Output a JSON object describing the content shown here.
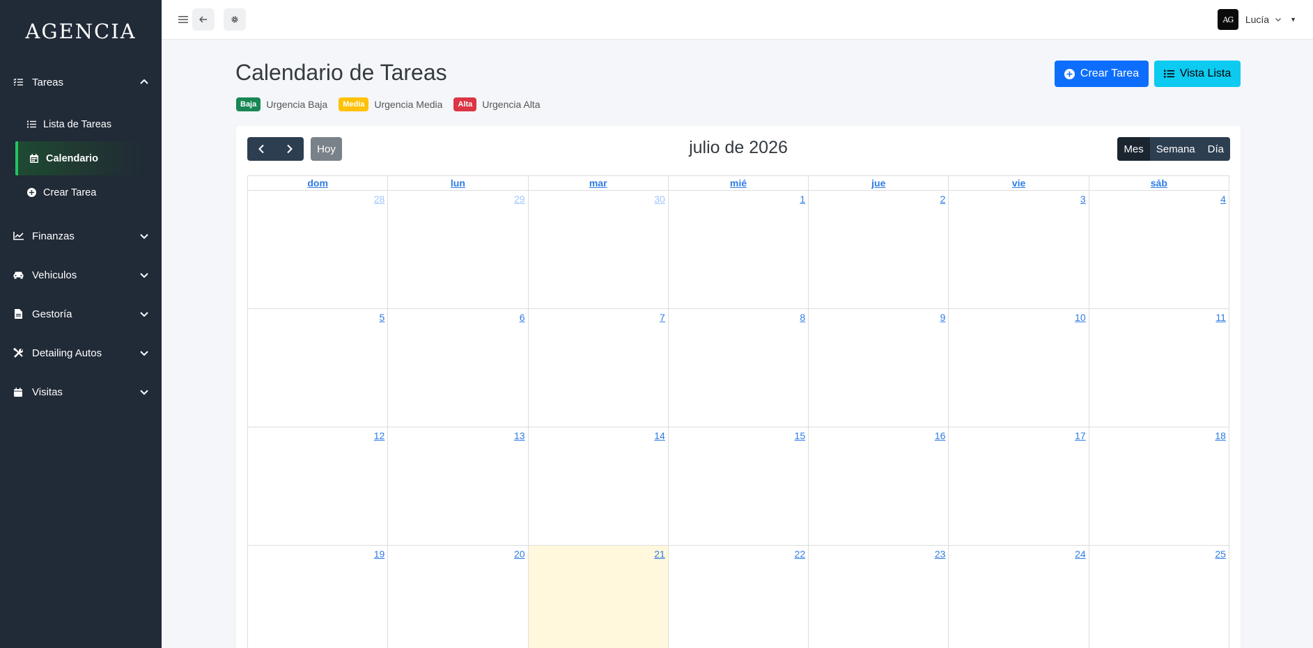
{
  "sidebar": {
    "brand": "AGENCIA",
    "sections": [
      {
        "label": "Tareas",
        "icon": "list-check-icon",
        "expanded": true,
        "items": [
          {
            "label": "Lista de Tareas",
            "icon": "list-icon"
          },
          {
            "label": "Calendario",
            "icon": "calendar-icon",
            "active": true
          },
          {
            "label": "Crear Tarea",
            "icon": "plus-circle-icon"
          }
        ]
      },
      {
        "label": "Finanzas",
        "icon": "chart-line-icon"
      },
      {
        "label": "Vehiculos",
        "icon": "car-icon"
      },
      {
        "label": "Gestoría",
        "icon": "file-icon"
      },
      {
        "label": "Detailing Autos",
        "icon": "tools-icon"
      },
      {
        "label": "Visitas",
        "icon": "calendar-icon"
      }
    ]
  },
  "topbar": {
    "user": {
      "avatar_text": "AG",
      "name": "Lucía"
    }
  },
  "page": {
    "title": "Calendario de Tareas",
    "legend": [
      {
        "badge": "Baja",
        "text": "Urgencia Baja",
        "color": "#198754"
      },
      {
        "badge": "Media",
        "text": "Urgencia Media",
        "color": "#ffc107"
      },
      {
        "badge": "Alta",
        "text": "Urgencia Alta",
        "color": "#dc3545"
      }
    ],
    "buttons": {
      "create": "Crear Tarea",
      "list": "Vista Lista"
    }
  },
  "calendar": {
    "title": "julio de 2026",
    "today_label": "Hoy",
    "views": [
      "Mes",
      "Semana",
      "Día"
    ],
    "active_view": "Mes",
    "weekdays": [
      "dom",
      "lun",
      "mar",
      "mié",
      "jue",
      "vie",
      "sáb"
    ],
    "weeks": [
      [
        {
          "d": "28",
          "other": true
        },
        {
          "d": "29",
          "other": true
        },
        {
          "d": "30",
          "other": true
        },
        {
          "d": "1"
        },
        {
          "d": "2"
        },
        {
          "d": "3"
        },
        {
          "d": "4"
        }
      ],
      [
        {
          "d": "5"
        },
        {
          "d": "6"
        },
        {
          "d": "7"
        },
        {
          "d": "8"
        },
        {
          "d": "9"
        },
        {
          "d": "10"
        },
        {
          "d": "11"
        }
      ],
      [
        {
          "d": "12"
        },
        {
          "d": "13"
        },
        {
          "d": "14"
        },
        {
          "d": "15"
        },
        {
          "d": "16"
        },
        {
          "d": "17"
        },
        {
          "d": "18"
        }
      ],
      [
        {
          "d": "19"
        },
        {
          "d": "20"
        },
        {
          "d": "21",
          "today": true
        },
        {
          "d": "22"
        },
        {
          "d": "23"
        },
        {
          "d": "24"
        },
        {
          "d": "25"
        }
      ]
    ]
  },
  "colors": {
    "sidebar_bg": "#212a37",
    "active_accent": "#22c55e",
    "primary": "#0d6efd",
    "info": "#0dcaf0",
    "today_bg": "#fff8dc"
  }
}
